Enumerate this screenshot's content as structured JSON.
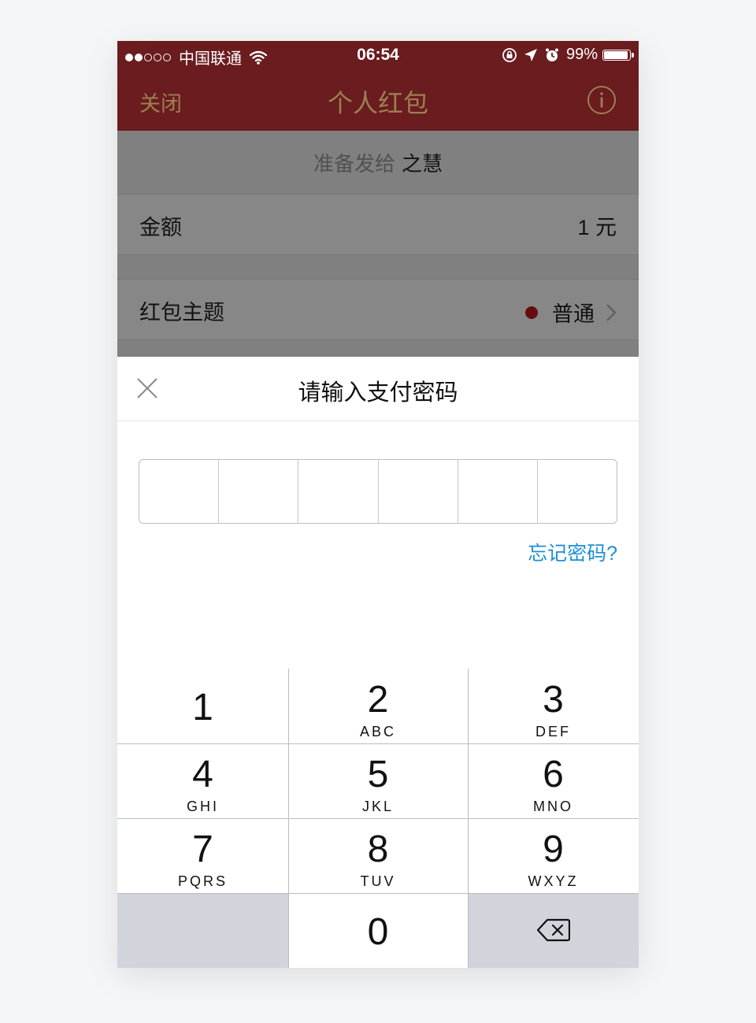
{
  "status_bar": {
    "carrier": "中国联通",
    "time": "06:54",
    "battery": "99%"
  },
  "nav": {
    "close_label": "关闭",
    "title": "个人红包"
  },
  "form": {
    "recipient_prefix": "准备发给",
    "recipient_name": "之慧",
    "amount_label": "金额",
    "amount_value": "1 元",
    "theme_label": "红包主题",
    "theme_value": "普通"
  },
  "sheet": {
    "title": "请输入支付密码",
    "forgot_label": "忘记密码?"
  },
  "keypad": {
    "keys": [
      {
        "digit": "1",
        "letters": ""
      },
      {
        "digit": "2",
        "letters": "ABC"
      },
      {
        "digit": "3",
        "letters": "DEF"
      },
      {
        "digit": "4",
        "letters": "GHI"
      },
      {
        "digit": "5",
        "letters": "JKL"
      },
      {
        "digit": "6",
        "letters": "MNO"
      },
      {
        "digit": "7",
        "letters": "PQRS"
      },
      {
        "digit": "8",
        "letters": "TUV"
      },
      {
        "digit": "9",
        "letters": "WXYZ"
      },
      {
        "digit": "0",
        "letters": ""
      }
    ]
  },
  "colors": {
    "header_bg": "#6a1c1f",
    "header_text": "#9c7f52",
    "link_blue": "#1e8fd8",
    "theme_dot": "#c0171d"
  }
}
